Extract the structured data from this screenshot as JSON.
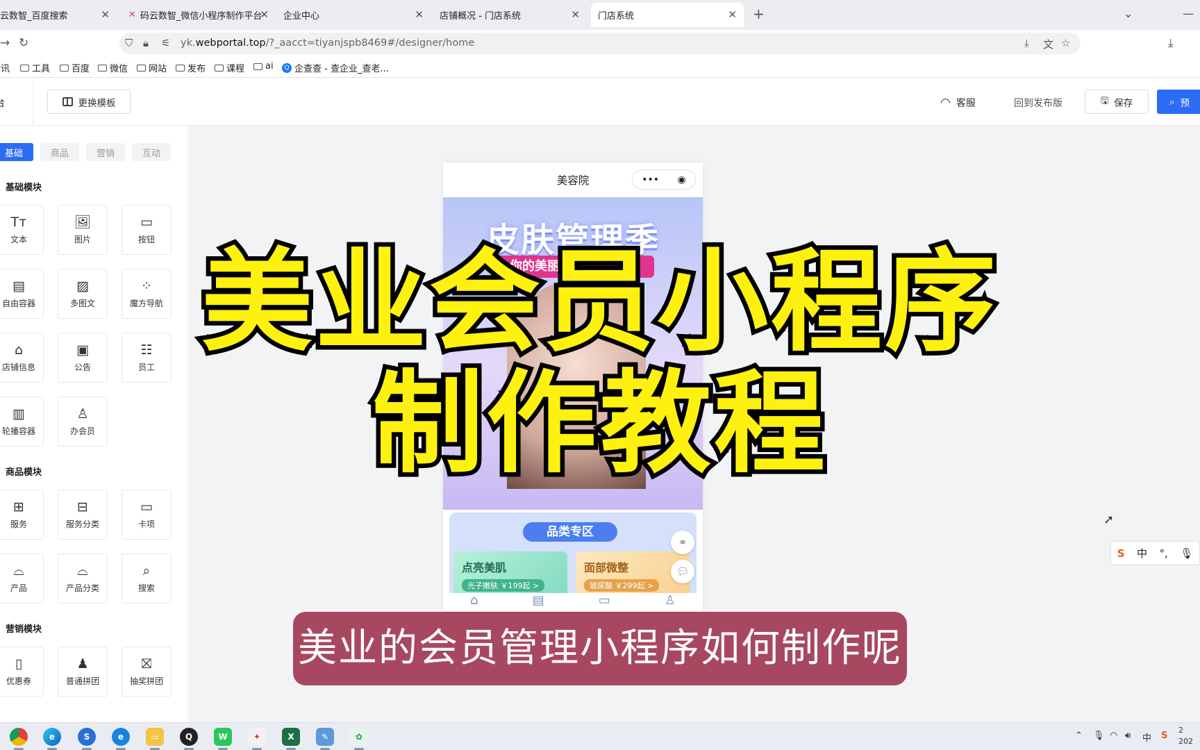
{
  "browser": {
    "tabs": [
      {
        "label": "云数智_百度搜索"
      },
      {
        "label": "码云数智_微信小程序制作平台"
      },
      {
        "label": "企业中心"
      },
      {
        "label": "店铺概况 - 门店系统"
      },
      {
        "label": "门店系统"
      }
    ],
    "url_prefix": "yk.",
    "url_domain": "webportal.top",
    "url_rest": "/?_aacct=tiyanjspb8469#/designer/home",
    "bookmarks": [
      "资讯",
      "工具",
      "百度",
      "微信",
      "网站",
      "发布",
      "课程",
      "ai",
      "企查查 - 查企业_查老..."
    ]
  },
  "header": {
    "first_char": "台",
    "change_template": "更换模板",
    "customer_service": "客服",
    "back_to_published": "回到发布版",
    "save": "保存",
    "preview": "预"
  },
  "left_panel": {
    "tabs": [
      "基础",
      "商品",
      "营销",
      "互动"
    ],
    "sections": [
      {
        "title": "基础模块",
        "items": [
          {
            "label": "文本",
            "icon": "Tт"
          },
          {
            "label": "图片",
            "icon": "🖼"
          },
          {
            "label": "按钮",
            "icon": "▭"
          },
          {
            "label": "自由容器",
            "icon": "▤"
          },
          {
            "label": "多图文",
            "icon": "▨"
          },
          {
            "label": "魔方导航",
            "icon": "⁘"
          },
          {
            "label": "店铺信息",
            "icon": "⌂"
          },
          {
            "label": "公告",
            "icon": "▣"
          },
          {
            "label": "员工",
            "icon": "☷"
          },
          {
            "label": "轮播容器",
            "icon": "▥"
          },
          {
            "label": "办会员",
            "icon": "♙"
          }
        ]
      },
      {
        "title": "商品模块",
        "items": [
          {
            "label": "服务",
            "icon": "⊞"
          },
          {
            "label": "服务分类",
            "icon": "⊟"
          },
          {
            "label": "卡项",
            "icon": "▭"
          },
          {
            "label": "产品",
            "icon": "⌓"
          },
          {
            "label": "产品分类",
            "icon": "⌓"
          },
          {
            "label": "搜索",
            "icon": "⌕"
          }
        ]
      },
      {
        "title": "营销模块",
        "items": [
          {
            "label": "优惠券",
            "icon": "▯"
          },
          {
            "label": "普通拼团",
            "icon": "♟"
          },
          {
            "label": "抽奖拼团",
            "icon": "⛝"
          }
        ]
      }
    ]
  },
  "phone": {
    "title": "美容院",
    "banner_title": "皮肤管理季",
    "banner_sub": "你的美丽",
    "category_title": "品类专区",
    "cards": [
      {
        "name": "点亮美肌",
        "tag": "光子嫩肤 ￥199起 >"
      },
      {
        "name": "面部微整",
        "tag": "玻尿酸 ￥299起 >"
      }
    ]
  },
  "overlay": {
    "line1": "美业会员小程序",
    "line2": "制作教程",
    "subtitle": "美业的会员管理小程序如何制作呢"
  },
  "ime": {
    "lang": "中",
    "punct": "°,"
  },
  "taskbar": {
    "tray_lang": "中",
    "clock_time": "2",
    "clock_date": "202"
  },
  "colors": {
    "primary": "#2b6cf5",
    "overlay_yellow": "#fef10f",
    "subtitle_bg": "#a84860"
  }
}
